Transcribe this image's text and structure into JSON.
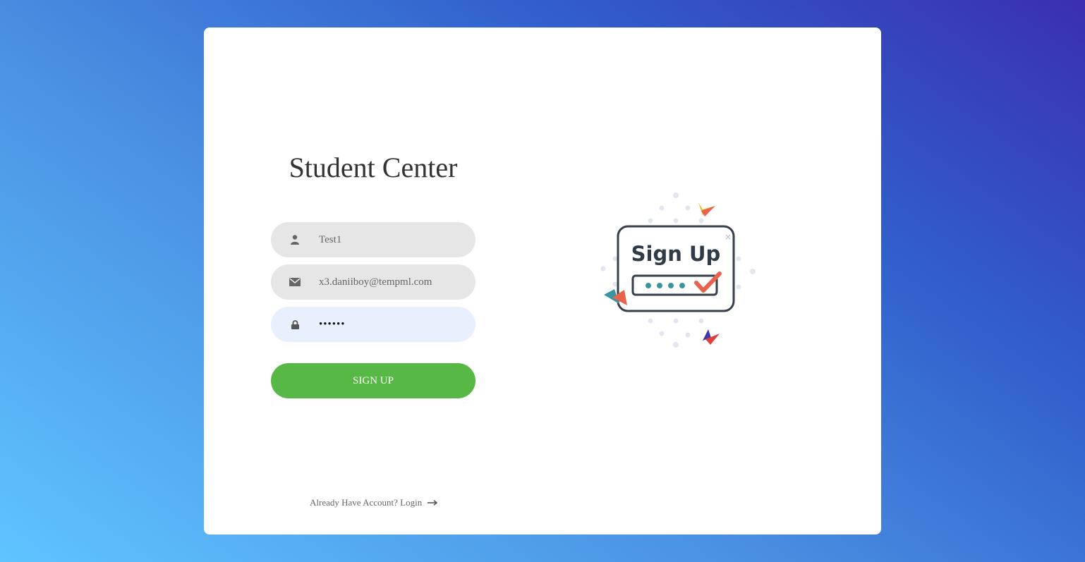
{
  "app": {
    "title": "Student Center"
  },
  "form": {
    "username": {
      "value": "Test1",
      "icon": "user-icon"
    },
    "email": {
      "value": "x3.daniiboy@tempml.com",
      "icon": "envelope-icon"
    },
    "password": {
      "value": "••••••",
      "icon": "lock-icon"
    },
    "submit_label": "SIGN UP"
  },
  "footer": {
    "login_link": "Already Have Account? Login",
    "arrow_icon": "arrow-right-icon"
  },
  "illustration": {
    "text": "Sign Up",
    "close_glyph": "×"
  },
  "colors": {
    "accent": "#57b846",
    "input_bg": "#e6e6e6",
    "input_autofill_bg": "#e8f0fe",
    "gradient_start": "#5fc4ff",
    "gradient_end": "#3a2fb0"
  }
}
